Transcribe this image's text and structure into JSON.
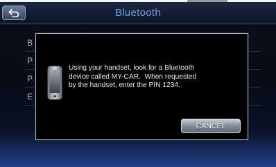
{
  "header": {
    "title": "Bluetooth",
    "back_icon": "back-arrow-icon"
  },
  "list": {
    "rows": [
      {
        "label": "B"
      },
      {
        "label": "P"
      },
      {
        "label": "P"
      },
      {
        "label": "E"
      }
    ]
  },
  "dialog": {
    "icon": "smartphone-icon",
    "message": "Using your handset, look for a Bluetooth\ndevice called MY-CAR.  When requested\nby the handset, enter the PIN 1234.",
    "cancel_label": "CANCEL"
  },
  "colors": {
    "title": "#6e9ee8",
    "background_top": "#0e1523",
    "background_bottom": "#2a4fa8",
    "dialog_border": "#aab4c8"
  }
}
